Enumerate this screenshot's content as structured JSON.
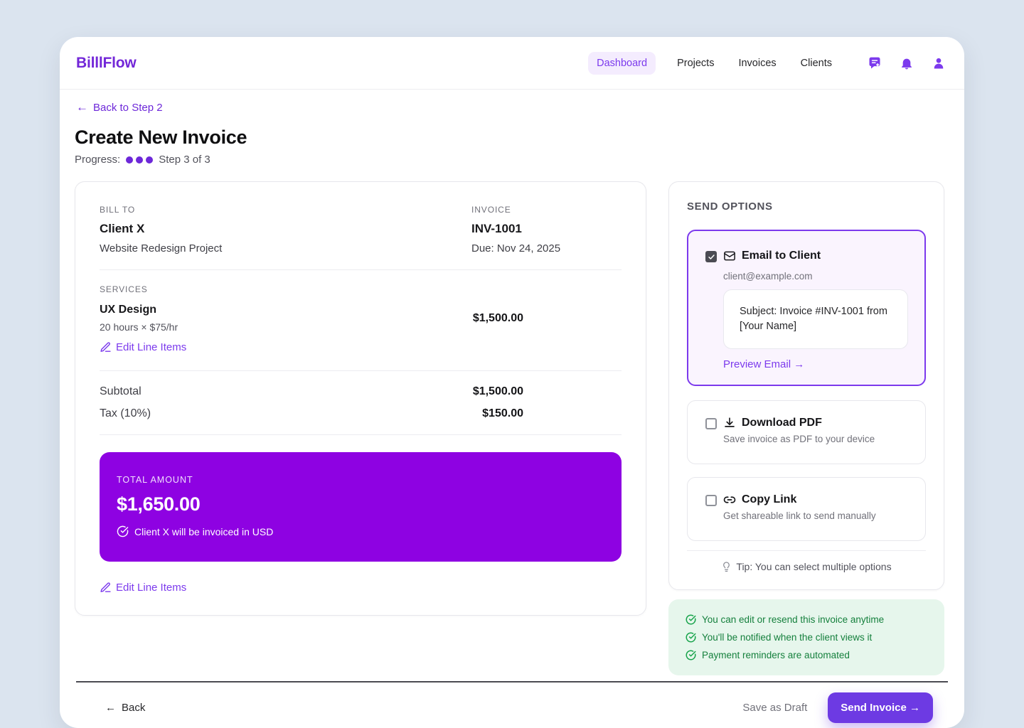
{
  "brand": "BilllFlow",
  "nav": {
    "items": [
      {
        "label": "Dashboard",
        "active": true
      },
      {
        "label": "Projects",
        "active": false
      },
      {
        "label": "Invoices",
        "active": false
      },
      {
        "label": "Clients",
        "active": false
      }
    ]
  },
  "back_link": {
    "label": "Back to Step 2"
  },
  "page": {
    "title": "Create New Invoice",
    "progress_label": "Progress:",
    "step_label": "Step 3 of 3"
  },
  "invoice": {
    "bill_to_label": "BILL TO",
    "client": "Client X",
    "project": "Website Redesign Project",
    "invoice_label": "INVOICE",
    "number": "INV-1001",
    "due": "Due: Nov 24, 2025",
    "services_label": "SERVICES",
    "line_items": [
      {
        "name": "UX Design",
        "detail": "20 hours × $75/hr",
        "amount": "$1,500.00"
      }
    ],
    "edit_link": "Edit Line Items",
    "subtotal_label": "Subtotal",
    "subtotal": "$1,500.00",
    "tax_label": "Tax (10%)",
    "tax": "$150.00",
    "total_label": "TOTAL AMOUNT",
    "total": "$1,650.00",
    "total_note": "Client X will be invoiced in USD"
  },
  "send_options": {
    "title": "SEND OPTIONS",
    "email": {
      "label": "Email to Client",
      "checked": true,
      "recipient": "client@example.com",
      "subject": "Subject: Invoice #INV-1001 from [Your Name]",
      "preview_label": "Preview Email →"
    },
    "pdf": {
      "label": "Download PDF",
      "checked": false,
      "desc": "Save invoice as PDF to your device"
    },
    "link": {
      "label": "Copy Link",
      "checked": false,
      "desc": "Get shareable link to send manually"
    },
    "tip": "Tip: You can select multiple options"
  },
  "notes": [
    "You can edit or resend this invoice anytime",
    "You'll be notified when the client views it",
    "Payment reminders are automated"
  ],
  "footer": {
    "back": "Back",
    "save_draft": "Save as Draft",
    "send": "Send Invoice →"
  },
  "icons": {
    "arrow_left": "←",
    "arrow_right": "→",
    "names": [
      "message-plus-icon",
      "bell-icon",
      "user-icon",
      "pencil-icon",
      "envelope-icon",
      "download-icon",
      "link-icon",
      "check-circle-icon",
      "lightbulb-icon",
      "checkbox"
    ]
  },
  "colors": {
    "accent": "#7c3aed",
    "total_bg": "#8e02e2",
    "send_button_bg": "#6d3ae3",
    "success_text": "#15803d",
    "notes_bg": "#e6f6ec",
    "page_bg": "#dbe4ef"
  }
}
